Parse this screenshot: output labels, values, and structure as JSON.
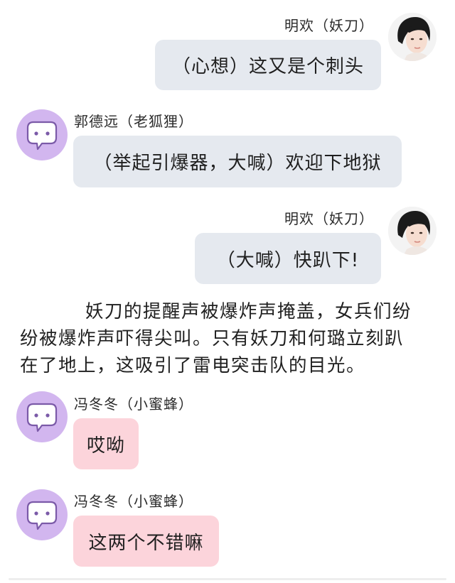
{
  "messages": [
    {
      "sender": "明欢（妖刀）",
      "text": "（心想）这又是个刺头",
      "side": "right",
      "avatar": "photo-avatar",
      "bubble_color": "#e5e9ef"
    },
    {
      "sender": "郭德远（老狐狸）",
      "text": "（举起引爆器，大喊）欢迎下地狱",
      "side": "left",
      "avatar": "chat-bubble-icon",
      "bubble_color": "#e5e9ef"
    },
    {
      "sender": "明欢（妖刀）",
      "text": "（大喊）快趴下!",
      "side": "right",
      "avatar": "photo-avatar",
      "bubble_color": "#e5e9ef"
    },
    {
      "sender": "冯冬冬（小蜜蜂）",
      "text": "哎呦",
      "side": "left",
      "avatar": "chat-bubble-icon",
      "bubble_color": "#fcd4db"
    },
    {
      "sender": "冯冬冬（小蜜蜂）",
      "text": "这两个不错嘛",
      "side": "left",
      "avatar": "chat-bubble-icon",
      "bubble_color": "#fcd4db"
    }
  ],
  "narration": {
    "line1": "妖刀的提醒声被爆炸声掩盖，女兵们纷",
    "line2": "纷被爆炸声吓得尖叫。只有妖刀和何璐立刻趴",
    "line3": "在了地上，这吸引了雷电突击队的目光。"
  },
  "colors": {
    "avatar_purple": "#d2b6ef",
    "bubble_gray": "#e5e9ef",
    "bubble_pink": "#fcd4db"
  }
}
